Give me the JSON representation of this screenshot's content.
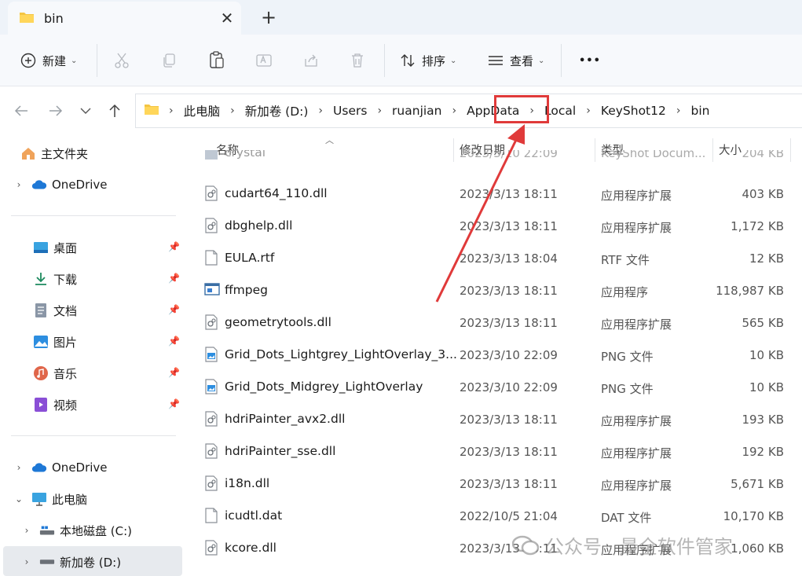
{
  "window": {
    "tab_title": "bin",
    "new_tab": "+",
    "close_tab": "✕"
  },
  "toolbar": {
    "new_label": "新建",
    "sort_label": "排序",
    "view_label": "查看",
    "more": "•••"
  },
  "address": {
    "crumbs": [
      "此电脑",
      "新加卷 (D:)",
      "Users",
      "ruanjian",
      "AppData",
      "Local",
      "KeyShot12",
      "bin"
    ],
    "highlight_color": "#e03a3a"
  },
  "sidebar": {
    "home": "主文件夹",
    "onedrive_top": "OneDrive",
    "quick": [
      {
        "label": "桌面",
        "icon": "desktop-icon"
      },
      {
        "label": "下载",
        "icon": "download-icon"
      },
      {
        "label": "文档",
        "icon": "document-icon"
      },
      {
        "label": "图片",
        "icon": "pictures-icon"
      },
      {
        "label": "音乐",
        "icon": "music-icon"
      },
      {
        "label": "视频",
        "icon": "video-icon"
      }
    ],
    "onedrive_bottom": "OneDrive",
    "this_pc": "此电脑",
    "drive_c": "本地磁盘 (C:)",
    "drive_d": "新加卷 (D:)"
  },
  "columns": {
    "name": "名称",
    "date": "修改日期",
    "type": "类型",
    "size": "大小"
  },
  "partial_row": {
    "name": "crystal",
    "date": "2023/3/10 22:09",
    "type": "KeyShot Docum...",
    "size": "204 KB"
  },
  "files": [
    {
      "name": "cudart64_110.dll",
      "date": "2023/3/13 18:11",
      "type": "应用程序扩展",
      "size": "403 KB",
      "icon": "dll"
    },
    {
      "name": "dbghelp.dll",
      "date": "2023/3/13 18:11",
      "type": "应用程序扩展",
      "size": "1,172 KB",
      "icon": "dll"
    },
    {
      "name": "EULA.rtf",
      "date": "2023/3/13 18:04",
      "type": "RTF 文件",
      "size": "12 KB",
      "icon": "doc"
    },
    {
      "name": "ffmpeg",
      "date": "2023/3/13 18:11",
      "type": "应用程序",
      "size": "118,987 KB",
      "icon": "exe"
    },
    {
      "name": "geometrytools.dll",
      "date": "2023/3/13 18:11",
      "type": "应用程序扩展",
      "size": "565 KB",
      "icon": "dll"
    },
    {
      "name": "Grid_Dots_Lightgrey_LightOverlay_3...",
      "date": "2023/3/10 22:09",
      "type": "PNG 文件",
      "size": "10 KB",
      "icon": "png"
    },
    {
      "name": "Grid_Dots_Midgrey_LightOverlay",
      "date": "2023/3/10 22:09",
      "type": "PNG 文件",
      "size": "10 KB",
      "icon": "png"
    },
    {
      "name": "hdriPainter_avx2.dll",
      "date": "2023/3/13 18:11",
      "type": "应用程序扩展",
      "size": "193 KB",
      "icon": "dll"
    },
    {
      "name": "hdriPainter_sse.dll",
      "date": "2023/3/13 18:11",
      "type": "应用程序扩展",
      "size": "192 KB",
      "icon": "dll"
    },
    {
      "name": "i18n.dll",
      "date": "2023/3/13 18:11",
      "type": "应用程序扩展",
      "size": "5,671 KB",
      "icon": "dll"
    },
    {
      "name": "icudtl.dat",
      "date": "2022/10/5 21:04",
      "type": "DAT 文件",
      "size": "10,170 KB",
      "icon": "doc"
    },
    {
      "name": "kcore.dll",
      "date": "2023/3/13 18:11",
      "type": "应用程序扩展",
      "size": "1,060 KB",
      "icon": "dll"
    }
  ],
  "watermark": "公众号 · 最全软件管家"
}
